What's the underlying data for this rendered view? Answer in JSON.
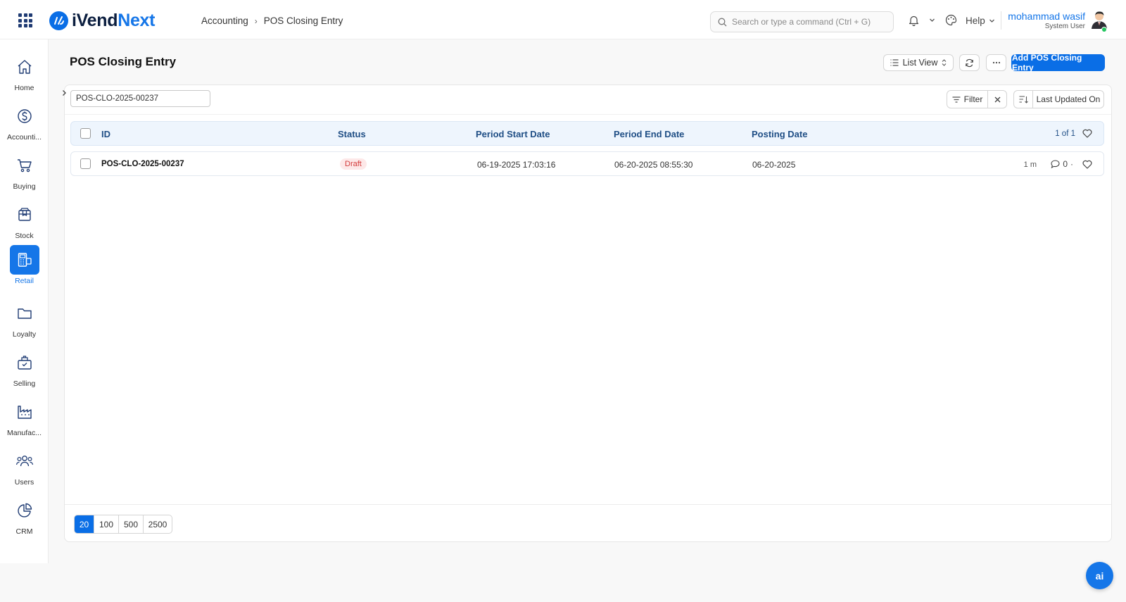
{
  "app": {
    "logo_part1": "iVend",
    "logo_part2": "Next",
    "brand_color": "#1576e8"
  },
  "breadcrumb": [
    "Accounting",
    "POS Closing Entry"
  ],
  "search": {
    "placeholder": "Search or type a command (Ctrl + G)"
  },
  "topbar": {
    "help_label": "Help"
  },
  "user": {
    "name": "mohammad wasif",
    "role": "System User"
  },
  "sidebar": {
    "items": [
      {
        "label": "Home",
        "icon": "home-icon"
      },
      {
        "label": "Accounti...",
        "icon": "dollar-icon"
      },
      {
        "label": "Buying",
        "icon": "cart-icon"
      },
      {
        "label": "Stock",
        "icon": "box-icon"
      },
      {
        "label": "Retail",
        "icon": "pos-terminal-icon",
        "active": true
      },
      {
        "label": "Loyalty",
        "icon": "folder-icon"
      },
      {
        "label": "Selling",
        "icon": "bag-icon"
      },
      {
        "label": "Manufac...",
        "icon": "factory-icon"
      },
      {
        "label": "Users",
        "icon": "users-icon"
      },
      {
        "label": "CRM",
        "icon": "pie-chart-icon"
      }
    ]
  },
  "page": {
    "title": "POS Closing Entry",
    "list_view_label": "List View",
    "add_button_label": "Add POS Closing Entry"
  },
  "filters": {
    "id_filter_value": "POS-CLO-2025-00237",
    "filter_label": "Filter",
    "sort_label": "Last Updated On"
  },
  "table": {
    "columns": [
      "ID",
      "Status",
      "Period Start Date",
      "Period End Date",
      "Posting Date"
    ],
    "count_label": "1 of 1",
    "rows": [
      {
        "id": "POS-CLO-2025-00237",
        "status": "Draft",
        "period_start": "06-19-2025 17:03:16",
        "period_end": "06-20-2025 08:55:30",
        "posting_date": "06-20-2025",
        "modified": "1 m",
        "comments": "0"
      }
    ]
  },
  "pagination": {
    "options": [
      "20",
      "100",
      "500",
      "2500"
    ],
    "selected": "20"
  },
  "ai_button": {
    "label": "ai"
  }
}
